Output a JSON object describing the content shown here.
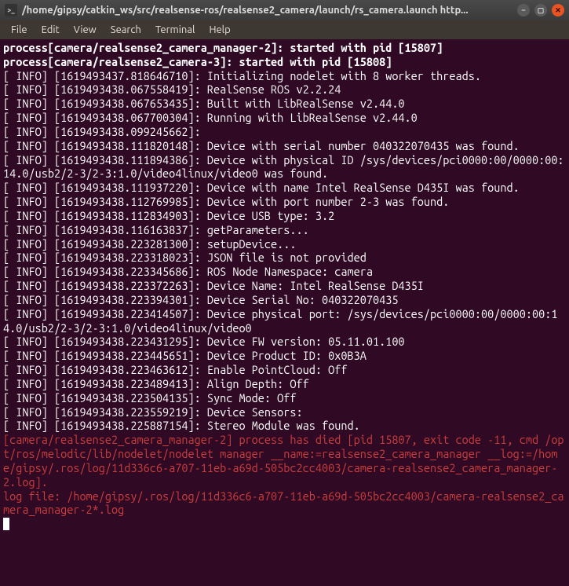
{
  "window": {
    "title": "/home/gipsy/catkin_ws/src/realsense-ros/realsense2_camera/launch/rs_camera.launch http..."
  },
  "menu": {
    "file": "File",
    "edit": "Edit",
    "view": "View",
    "search": "Search",
    "terminal": "Terminal",
    "help": "Help"
  },
  "terminal": {
    "lines": [
      {
        "cls": "bold",
        "text": "process[camera/realsense2_camera_manager-2]: started with pid [15807]"
      },
      {
        "cls": "bold",
        "text": "process[camera/realsense2_camera-3]: started with pid [15808]"
      },
      {
        "cls": "",
        "text": "[ INFO] [1619493437.818646710]: Initializing nodelet with 8 worker threads."
      },
      {
        "cls": "",
        "text": "[ INFO] [1619493438.067558419]: RealSense ROS v2.2.24"
      },
      {
        "cls": "",
        "text": "[ INFO] [1619493438.067653435]: Built with LibRealSense v2.44.0"
      },
      {
        "cls": "",
        "text": "[ INFO] [1619493438.067700304]: Running with LibRealSense v2.44.0"
      },
      {
        "cls": "",
        "text": "[ INFO] [1619493438.099245662]: "
      },
      {
        "cls": "",
        "text": "[ INFO] [1619493438.111820148]: Device with serial number 040322070435 was found."
      },
      {
        "cls": "",
        "text": ""
      },
      {
        "cls": "",
        "text": "[ INFO] [1619493438.111894386]: Device with physical ID /sys/devices/pci0000:00/0000:00:14.0/usb2/2-3/2-3:1.0/video4linux/video0 was found."
      },
      {
        "cls": "",
        "text": "[ INFO] [1619493438.111937220]: Device with name Intel RealSense D435I was found."
      },
      {
        "cls": "",
        "text": "[ INFO] [1619493438.112769985]: Device with port number 2-3 was found."
      },
      {
        "cls": "",
        "text": "[ INFO] [1619493438.112834903]: Device USB type: 3.2"
      },
      {
        "cls": "",
        "text": "[ INFO] [1619493438.116163837]: getParameters..."
      },
      {
        "cls": "",
        "text": "[ INFO] [1619493438.223281300]: setupDevice..."
      },
      {
        "cls": "",
        "text": "[ INFO] [1619493438.223318023]: JSON file is not provided"
      },
      {
        "cls": "",
        "text": "[ INFO] [1619493438.223345686]: ROS Node Namespace: camera"
      },
      {
        "cls": "",
        "text": "[ INFO] [1619493438.223372263]: Device Name: Intel RealSense D435I"
      },
      {
        "cls": "",
        "text": "[ INFO] [1619493438.223394301]: Device Serial No: 040322070435"
      },
      {
        "cls": "",
        "text": "[ INFO] [1619493438.223414507]: Device physical port: /sys/devices/pci0000:00/0000:00:14.0/usb2/2-3/2-3:1.0/video4linux/video0"
      },
      {
        "cls": "",
        "text": "[ INFO] [1619493438.223431295]: Device FW version: 05.11.01.100"
      },
      {
        "cls": "",
        "text": "[ INFO] [1619493438.223445651]: Device Product ID: 0x0B3A"
      },
      {
        "cls": "",
        "text": "[ INFO] [1619493438.223463612]: Enable PointCloud: Off"
      },
      {
        "cls": "",
        "text": "[ INFO] [1619493438.223489413]: Align Depth: Off"
      },
      {
        "cls": "",
        "text": "[ INFO] [1619493438.223504135]: Sync Mode: Off"
      },
      {
        "cls": "",
        "text": "[ INFO] [1619493438.223559219]: Device Sensors: "
      },
      {
        "cls": "",
        "text": "[ INFO] [1619493438.225887154]: Stereo Module was found."
      },
      {
        "cls": "red",
        "text": "[camera/realsense2_camera_manager-2] process has died [pid 15807, exit code -11, cmd /opt/ros/melodic/lib/nodelet/nodelet manager __name:=realsense2_camera_manager __log:=/home/gipsy/.ros/log/11d336c6-a707-11eb-a69d-505bc2cc4003/camera-realsense2_camera_manager-2.log]."
      },
      {
        "cls": "red",
        "text": "log file: /home/gipsy/.ros/log/11d336c6-a707-11eb-a69d-505bc2cc4003/camera-realsense2_camera_manager-2*.log"
      }
    ]
  }
}
